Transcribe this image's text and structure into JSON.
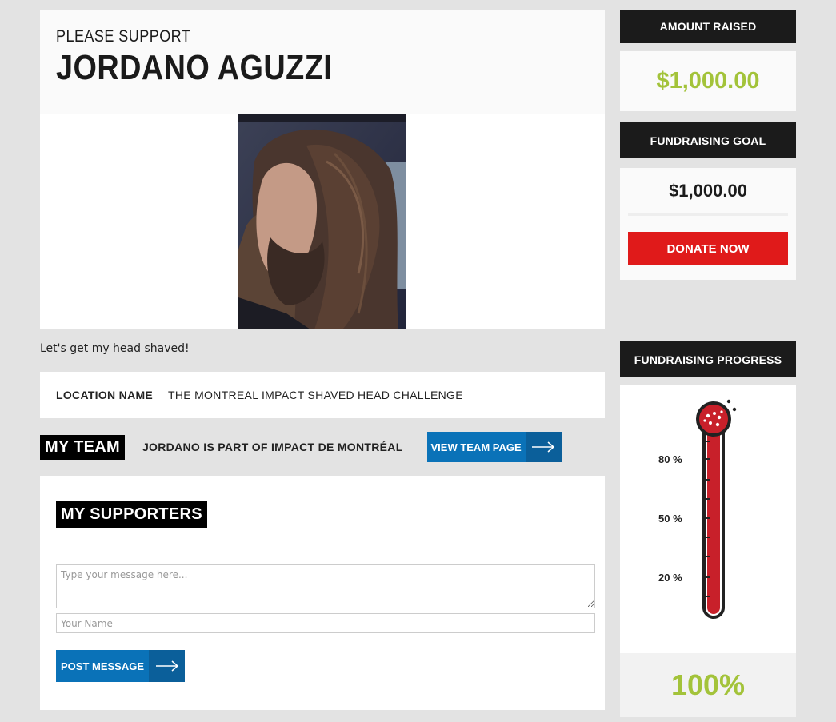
{
  "header": {
    "kicker": "PLEASE SUPPORT",
    "name": "JORDANO AGUZZI"
  },
  "tagline": "Let's get my head shaved!",
  "location": {
    "label": "LOCATION NAME",
    "value": "THE MONTREAL IMPACT SHAVED HEAD CHALLENGE"
  },
  "team": {
    "tag": "MY TEAM",
    "text": "JORDANO IS PART OF IMPACT DE MONTRÉAL",
    "button": "VIEW TEAM PAGE"
  },
  "supporters": {
    "tag": "MY SUPPORTERS",
    "message_placeholder": "Type your message here...",
    "name_placeholder": "Your Name",
    "post_button": "POST MESSAGE"
  },
  "sidebar": {
    "raised_label": "AMOUNT RAISED",
    "raised_value": "$1,000.00",
    "goal_label": "FUNDRAISING GOAL",
    "goal_value": "$1,000.00",
    "donate_button": "DONATE NOW",
    "progress_label": "FUNDRAISING PROGRESS",
    "thermo_ticks": [
      "80 %",
      "50 %",
      "20 %"
    ],
    "progress_fraction": 1.0,
    "progress_percent": "100%"
  },
  "colors": {
    "accent_green": "#a3c33a",
    "donate_red": "#e01a1a",
    "button_blue": "#0a72b8",
    "thermo_red": "#c8202a"
  },
  "icons": {
    "arrow": "arrow-right-icon"
  }
}
